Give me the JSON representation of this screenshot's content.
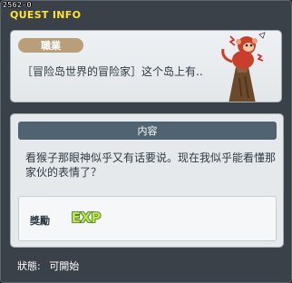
{
  "quest_id": "2562-0",
  "window_title": "QUEST INFO",
  "header": {
    "job_tag": "職業",
    "quest_name": "［冒险岛世界的冒险家］这个岛上有.."
  },
  "content": {
    "section_title": "内容",
    "description": "看猴子那眼神似乎又有话要说。现在我似乎能看懂那家伙的表情了？",
    "reward_label": "獎勵",
    "reward_item": "EXP"
  },
  "status": {
    "label": "狀態:",
    "value": "可開始"
  },
  "colors": {
    "title": "#ffe23a",
    "job_tag": "#b89f7a",
    "section_header": "#4f6373",
    "exp": "#9cd13a"
  }
}
